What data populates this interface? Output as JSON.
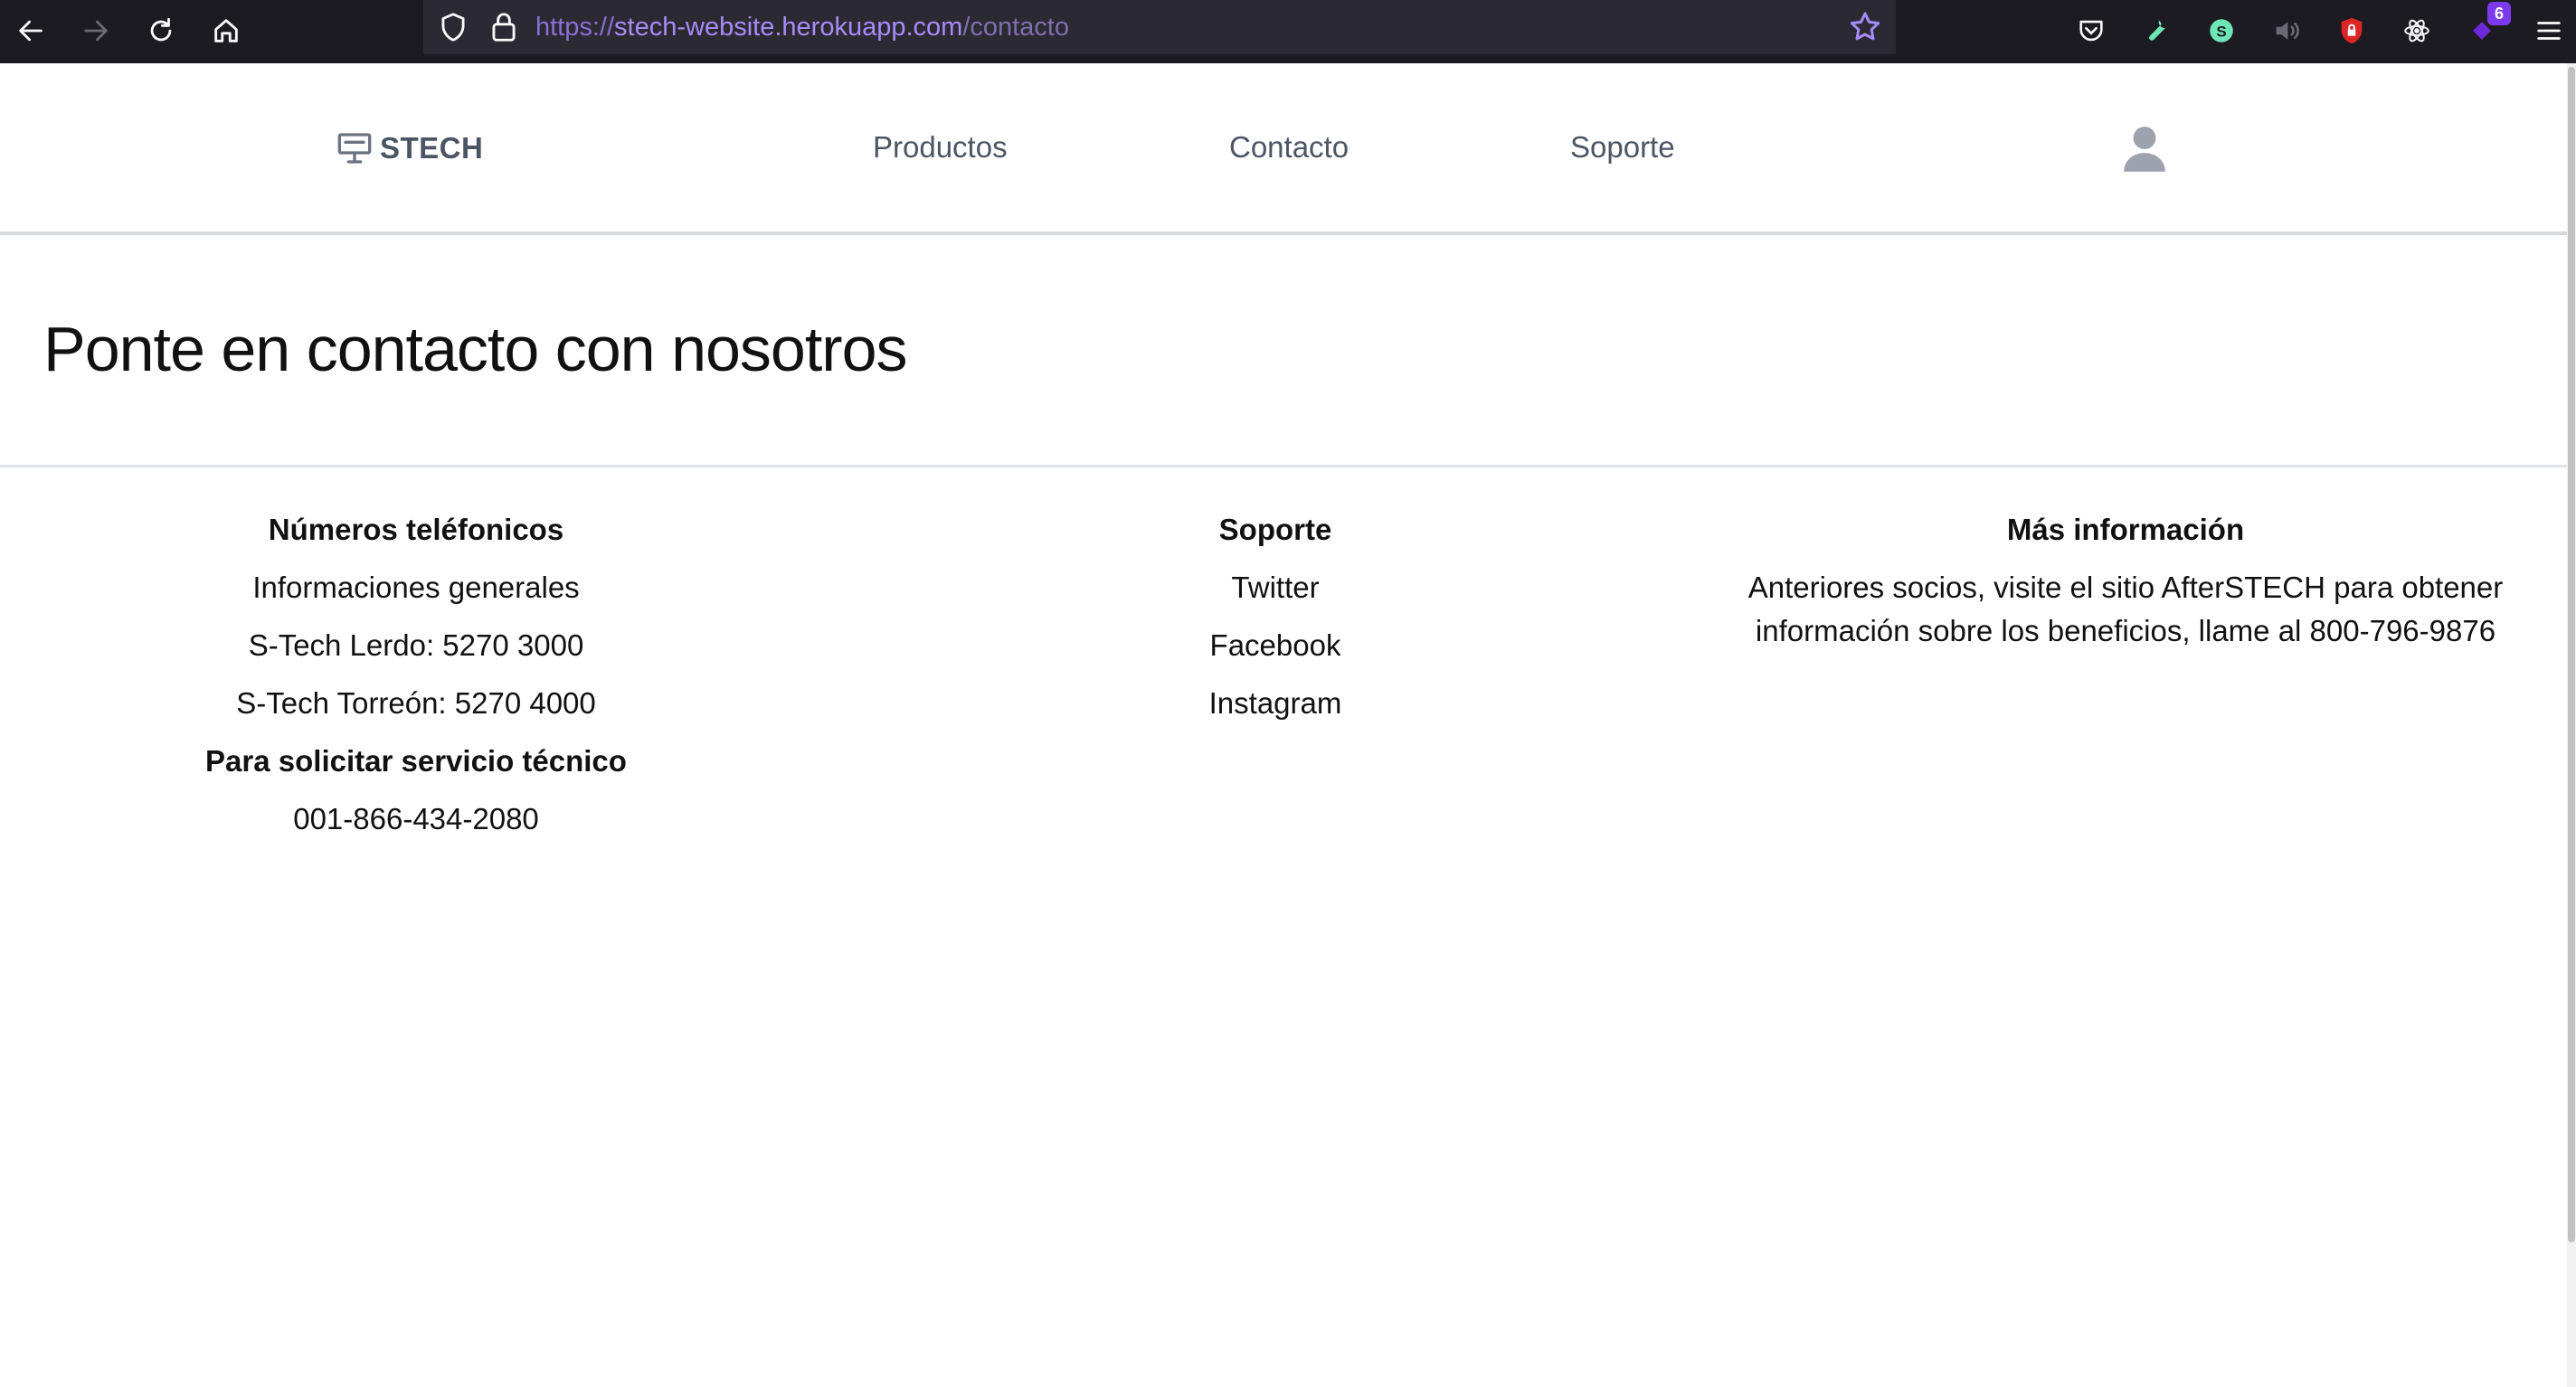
{
  "browser": {
    "url_scheme": "https://",
    "url_host": "stech-website.herokuapp.com",
    "url_path": "/contacto",
    "extension_badge": "6"
  },
  "header": {
    "logo_text": "STECH",
    "nav": {
      "productos": "Productos",
      "contacto": "Contacto",
      "soporte": "Soporte"
    }
  },
  "main": {
    "title": "Ponte en contacto con nosotros"
  },
  "columns": {
    "phones": {
      "heading": "Números teléfonicos",
      "general": "Informaciones generales",
      "lerdo": "S-Tech Lerdo: 5270 3000",
      "torreon": "S-Tech Torreón: 5270 4000",
      "service_heading": "Para solicitar servicio técnico",
      "service_phone": "001-866-434-2080"
    },
    "support": {
      "heading": "Soporte",
      "twitter": "Twitter",
      "facebook": "Facebook",
      "instagram": "Instagram"
    },
    "more": {
      "heading": "Más información",
      "text": "Anteriores socios, visite el sitio AfterSTECH para obtener información sobre los beneficios, llame al 800-796-9876"
    }
  },
  "colors": {
    "toolbar_bg": "#1c1b22",
    "urlbar_bg": "#2b2a33",
    "nav_text": "#4b5563",
    "url_host": "#a78bfa"
  }
}
